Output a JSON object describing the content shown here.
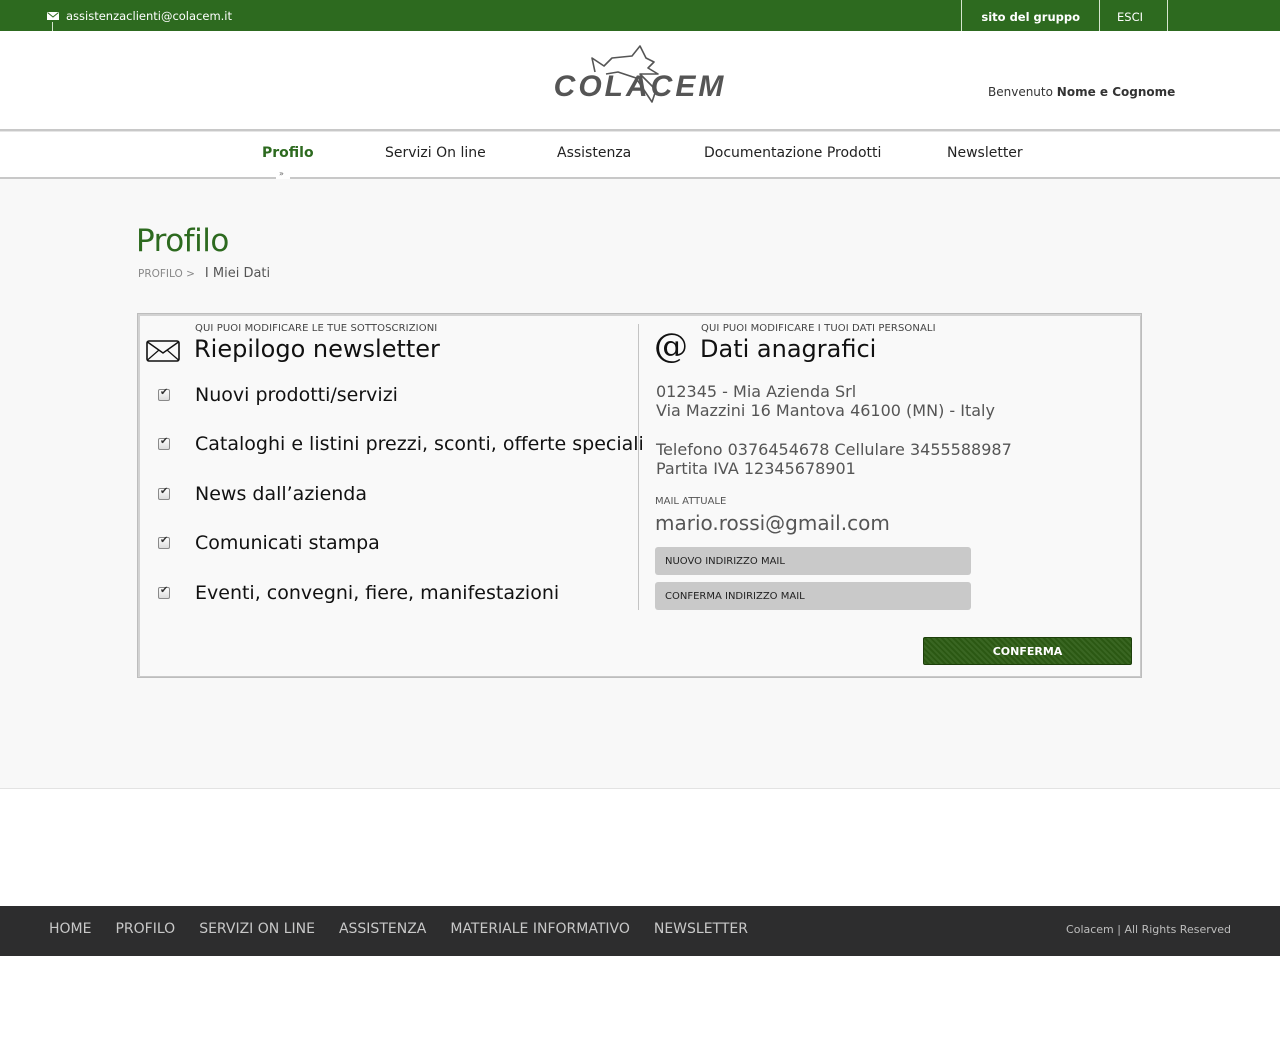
{
  "topbar": {
    "email": "assistenzaclienti@colacem.it",
    "links": [
      "sito del gruppo",
      "ESCI"
    ]
  },
  "header": {
    "logo_text": "COLACEM",
    "welcome_prefix": "Benvenuto",
    "user_name": "Nome e Cognome"
  },
  "nav": {
    "items": [
      "Profilo",
      "Servizi On line",
      "Assistenza",
      "Documentazione Prodotti",
      "Newsletter"
    ],
    "active": "Profilo"
  },
  "page": {
    "title": "Profilo",
    "breadcrumb_root": "PROFILO >",
    "breadcrumb_current": "I Miei Dati"
  },
  "newsletter": {
    "subtitle": "QUI PUOI MODIFICARE LE TUE SOTTOSCRIZIONI",
    "title": "Riepilogo newsletter",
    "items": [
      {
        "label": "Nuovi prodotti/servizi",
        "checked": true
      },
      {
        "label": "Cataloghi e listini prezzi, sconti, offerte speciali",
        "checked": true
      },
      {
        "label": "News dall’azienda",
        "checked": true
      },
      {
        "label": "Comunicati stampa",
        "checked": true
      },
      {
        "label": "Eventi, convegni, fiere, manifestazioni",
        "checked": true
      }
    ]
  },
  "anagrafica": {
    "subtitle": "QUI PUOI MODIFICARE I TUOI DATI PERSONALI",
    "title": "Dati anagrafici",
    "line1": "012345 -  Mia Azienda Srl",
    "line2": "Via Mazzini  16 Mantova 46100 (MN) - Italy",
    "line3": "Telefono 0376454678 Cellulare 3455588987",
    "line4": "Partita IVA 12345678901",
    "mail_label": "MAIL ATTUALE",
    "mail_value": "mario.rossi@gmail.com",
    "new_mail_placeholder": "NUOVO INDIRIZZO MAIL",
    "confirm_mail_placeholder": "CONFERMA INDIRIZZO MAIL",
    "confirm_button": "CONFERMA"
  },
  "footer": {
    "links": [
      "HOME",
      "PROFILO",
      "SERVIZI ON LINE",
      "ASSISTENZA",
      "MATERIALE INFORMATIVO",
      "NEWSLETTER"
    ],
    "copyright": "Colacem | All Rights Reserved"
  },
  "colors": {
    "brand_green": "#2d6a1f",
    "button_green": "#2d5c14",
    "footer_bg": "#2d2d2e"
  }
}
